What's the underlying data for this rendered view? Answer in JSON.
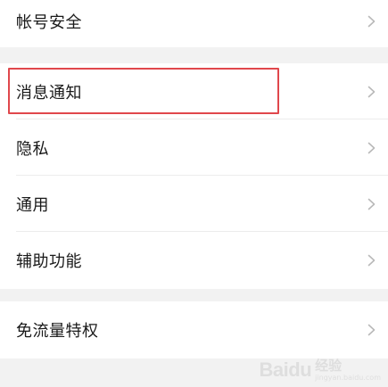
{
  "settings": {
    "account_security": {
      "label": "帐号安全",
      "icon": "chevron-right-icon"
    },
    "notifications": {
      "label": "消息通知",
      "icon": "chevron-right-icon"
    },
    "privacy": {
      "label": "隐私",
      "icon": "chevron-right-icon"
    },
    "general": {
      "label": "通用",
      "icon": "chevron-right-icon"
    },
    "accessibility": {
      "label": "辅助功能",
      "icon": "chevron-right-icon"
    },
    "data_saver": {
      "label": "免流量特权",
      "icon": "chevron-right-icon"
    }
  },
  "annotation": {
    "highlight_color": "#e0474c"
  },
  "watermark": {
    "logo_text": "Baidu",
    "cn_text": "经验",
    "en_text": "jingyan.baidu.com"
  }
}
